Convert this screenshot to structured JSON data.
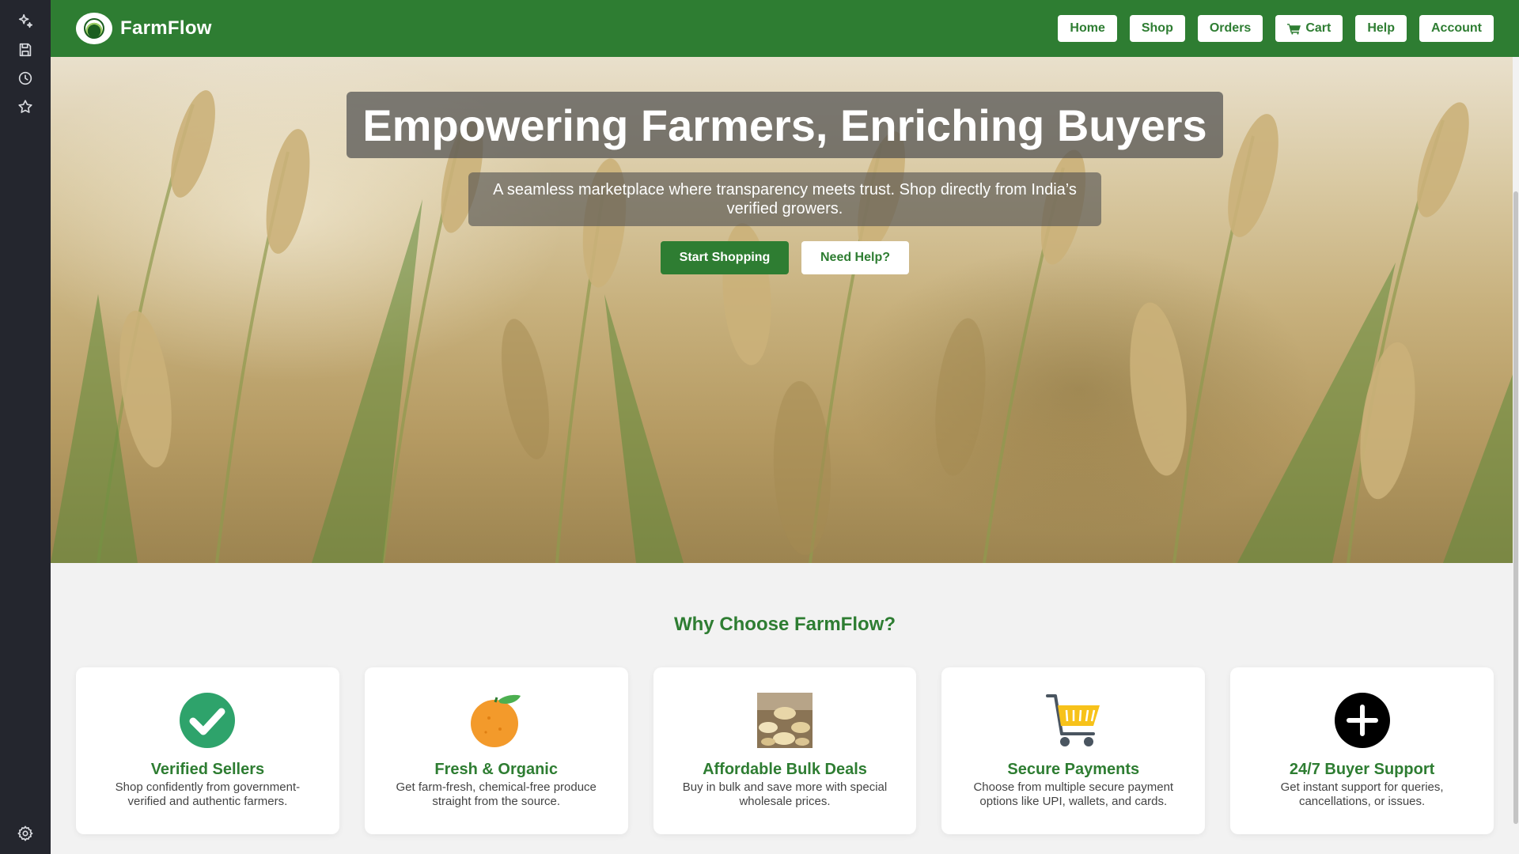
{
  "rail": {
    "items": [
      {
        "icon": "sparkle-icon"
      },
      {
        "icon": "save-icon"
      },
      {
        "icon": "history-icon"
      },
      {
        "icon": "star-icon"
      }
    ],
    "bottom_icon": "settings-icon"
  },
  "navbar": {
    "brand": "FarmFlow",
    "links": [
      "Home",
      "Shop",
      "Orders",
      "Cart",
      "Help",
      "Account"
    ]
  },
  "hero": {
    "title": "Empowering Farmers, Enriching Buyers",
    "subtitle": "A seamless marketplace where transparency meets trust. Shop directly from India’s verified growers.",
    "primary_button": "Start Shopping",
    "secondary_button": "Need Help?"
  },
  "features": {
    "title": "Why Choose FarmFlow?",
    "cards": [
      {
        "icon": "check-badge-icon",
        "title": "Verified Sellers",
        "desc": "Shop confidently from government-verified and authentic farmers."
      },
      {
        "icon": "orange-icon",
        "title": "Fresh & Organic",
        "desc": "Get farm-fresh, chemical-free produce straight from the source."
      },
      {
        "icon": "grain-sacks-icon",
        "title": "Affordable Bulk Deals",
        "desc": "Buy in bulk and save more with special wholesale prices."
      },
      {
        "icon": "shopping-cart-icon",
        "title": "Secure Payments",
        "desc": "Choose from multiple secure payment options like UPI, wallets, and cards."
      },
      {
        "icon": "plus-circle-icon",
        "title": "24/7 Buyer Support",
        "desc": "Get instant support for queries, cancellations, or issues."
      }
    ]
  },
  "colors": {
    "brand_green": "#2e7d32",
    "rail_bg": "#24262e",
    "page_bg": "#f2f2f2"
  }
}
